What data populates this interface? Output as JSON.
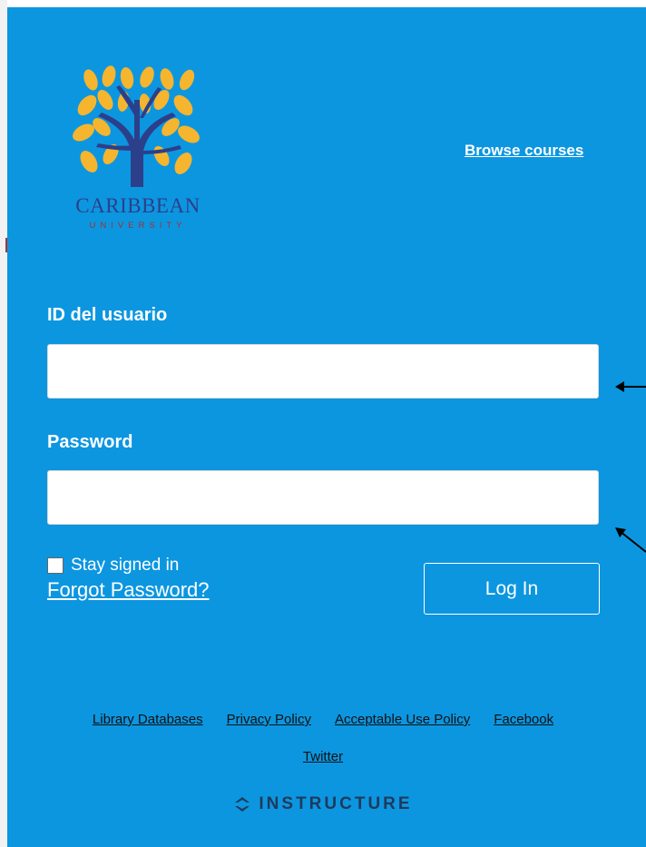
{
  "branding": {
    "logo_title": "CARIBBEAN",
    "logo_subtitle": "UNIVERSITY"
  },
  "header": {
    "browse_label": "Browse courses"
  },
  "login": {
    "username_label": "ID del usuario",
    "username_value": "",
    "password_label": "Password",
    "password_value": "",
    "remember_label": "Stay signed in",
    "remember_checked": false,
    "forgot_label": "Forgot Password?",
    "submit_label": "Log In"
  },
  "footer": {
    "links": [
      "Library Databases",
      "Privacy Policy",
      "Acceptable Use Policy",
      "Facebook",
      "Twitter"
    ],
    "powered_by": "INSTRUCTURE"
  },
  "colors": {
    "background": "#0c96e0",
    "logo_leaf": "#f5b52e",
    "logo_trunk": "#2c3f8a"
  },
  "icons": {
    "logo": "tree-logo-icon",
    "powered_by": "instructure-icon",
    "annotation": "arrow-icon"
  }
}
